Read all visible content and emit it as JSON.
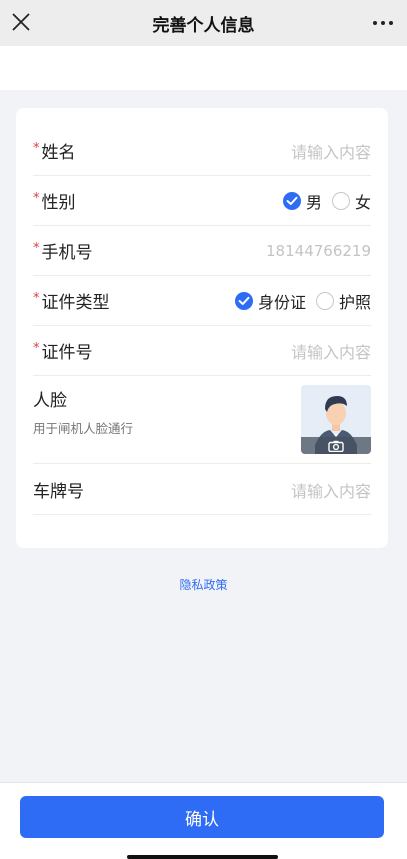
{
  "header": {
    "title": "完善个人信息",
    "close_icon": "close-icon",
    "more_icon": "more-icon"
  },
  "form": {
    "name": {
      "label": "姓名",
      "required_mark": "*",
      "placeholder": "请输入内容"
    },
    "gender": {
      "label": "性别",
      "required_mark": "*",
      "options": [
        {
          "label": "男",
          "checked": true
        },
        {
          "label": "女",
          "checked": false
        }
      ]
    },
    "phone": {
      "label": "手机号",
      "required_mark": "*",
      "value": "18144766219"
    },
    "id_type": {
      "label": "证件类型",
      "required_mark": "*",
      "options": [
        {
          "label": "身份证",
          "checked": true
        },
        {
          "label": "护照",
          "checked": false
        }
      ]
    },
    "id_number": {
      "label": "证件号",
      "required_mark": "*",
      "placeholder": "请输入内容"
    },
    "face": {
      "label": "人脸",
      "subtitle": "用于闸机人脸通行"
    },
    "plate": {
      "label": "车牌号",
      "placeholder": "请输入内容"
    }
  },
  "privacy_link": "隐私政策",
  "confirm_label": "确认",
  "colors": {
    "accent": "#2f6cf6",
    "required": "#e33b3b"
  }
}
